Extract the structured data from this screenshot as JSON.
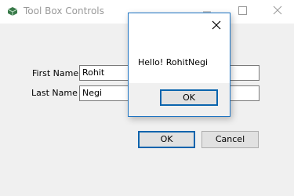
{
  "window": {
    "title": "Tool Box Controls",
    "icon": "toolbox-app-icon",
    "controls": [
      "minimize-icon",
      "maximize-icon",
      "close-icon"
    ]
  },
  "form": {
    "first_name_label": "First Name",
    "first_name_value": "Rohit",
    "last_name_label": "Last Name",
    "last_name_value": "Negi",
    "ok_label": "OK",
    "cancel_label": "Cancel"
  },
  "dialog": {
    "message": "Hello! RohitNegi",
    "ok_label": "OK",
    "accent_color": "#1c73c3"
  }
}
